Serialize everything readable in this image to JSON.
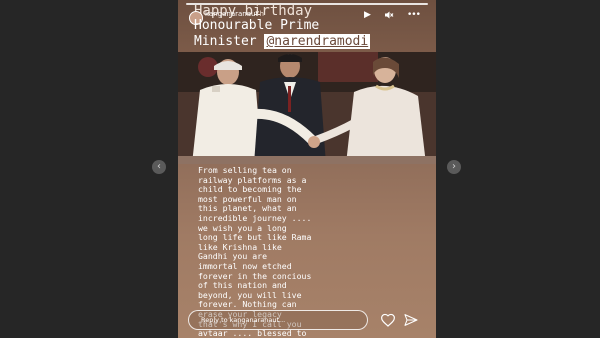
{
  "nav": {
    "prev_icon": "chevron-left-icon",
    "next_icon": "chevron-right-icon"
  },
  "story": {
    "username": "kanganaranaut",
    "time": "7h",
    "controls": {
      "play": "▶",
      "mute": "🔇",
      "more": "•••"
    },
    "caption": {
      "line1": "Happy birthday",
      "line2": "Honourable Prime",
      "line3_prefix": "Minister ",
      "mention": "@narendramodi"
    },
    "body": "From selling tea on\nrailway platforms as a\nchild to becoming the\nmost powerful man on\nthis planet, what an\nincredible journey ....\nwe wish you a long\nlong life but like Rama\nlike Krishna like\nGandhi you are\nimmortal now etched\nforever in the concious\nof this nation and\nbeyond, you will live\nforever. Nothing can\nerase your legacy\nthat's why I call you\navtaar .... blessed to\nhave you as our leader",
    "reply_placeholder": "Reply to kanganaranaut..."
  }
}
